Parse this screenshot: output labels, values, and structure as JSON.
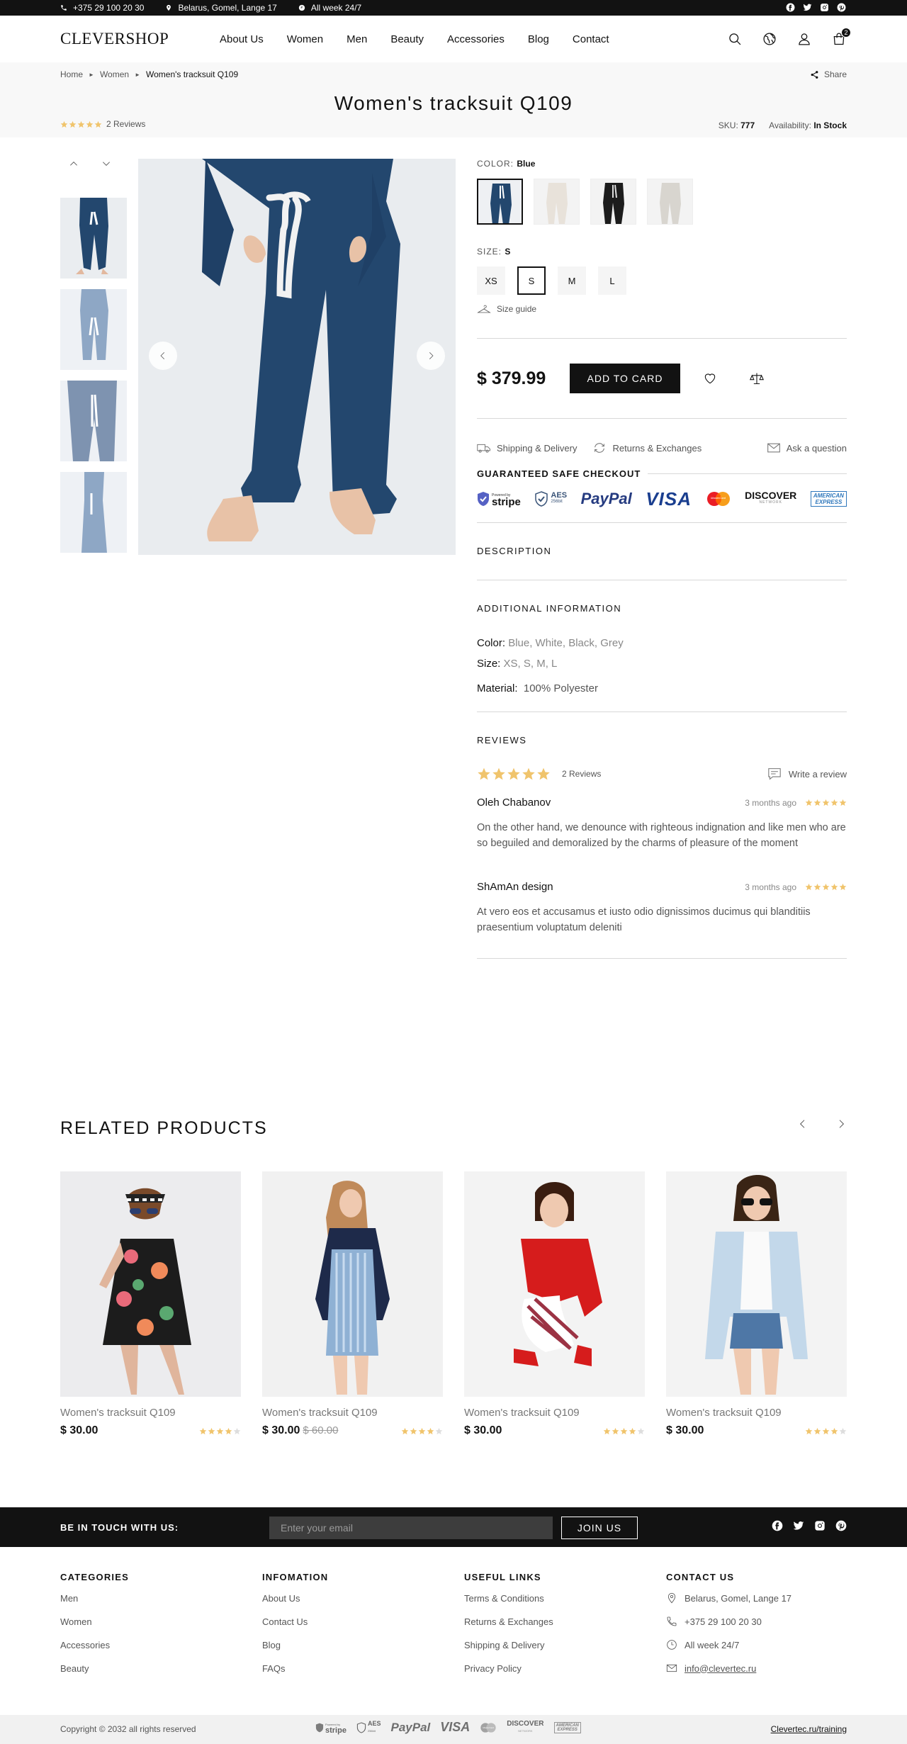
{
  "topbar": {
    "phone": "+375 29 100 20 30",
    "address": "Belarus, Gomel, Lange 17",
    "hours": "All week 24/7",
    "socials": [
      "facebook-icon",
      "twitter-icon",
      "instagram-icon",
      "pinterest-icon"
    ]
  },
  "header": {
    "logo": "CLEVERSHOP",
    "nav": [
      "About Us",
      "Women",
      "Men",
      "Beauty",
      "Accessories",
      "Blog",
      "Contact"
    ],
    "cart_count": "2"
  },
  "breadcrumb": {
    "home": "Home",
    "category": "Women",
    "current": "Women's tracksuit Q109",
    "share": "Share"
  },
  "product": {
    "title": "Women's tracksuit Q109",
    "reviews_count": "2 Reviews",
    "rating": 5,
    "sku_label": "SKU:",
    "sku": "777",
    "availability_label": "Availability:",
    "availability": "In Stock",
    "color_label": "COLOR:",
    "color": "Blue",
    "color_options": [
      "Blue",
      "White",
      "Black",
      "Grey"
    ],
    "size_label": "SIZE:",
    "size": "S",
    "sizes": [
      "XS",
      "S",
      "M",
      "L"
    ],
    "size_guide": "Size guide",
    "price": "$ 379.99",
    "add_to_cart": "ADD TO CARD",
    "shipping": "Shipping & Delivery",
    "returns": "Returns & Exchanges",
    "ask": "Ask a question",
    "safe_checkout": "GUARANTEED SAFE CHECKOUT",
    "payments": {
      "stripe": "stripe",
      "stripe_top": "Powered by",
      "aes": "AES",
      "aes_sub": "256bit",
      "paypal": "PayPal",
      "visa": "VISA",
      "mastercard": "MasterCard",
      "discover": "DISCOVER",
      "discover_sub": "NETWORK",
      "amex1": "AMERICAN",
      "amex2": "EXPRESS"
    }
  },
  "tabs": {
    "description": "DESCRIPTION",
    "additional": "ADDITIONAL INFORMATION",
    "reviews": "REVIEWS"
  },
  "additional_info": {
    "color_label": "Color:",
    "color_value": "Blue, White, Black, Grey",
    "size_label": "Size:",
    "size_value": "XS, S, M, L",
    "material_label": "Material:",
    "material_value": "100% Polyester"
  },
  "reviews": {
    "count": "2 Reviews",
    "write": "Write a review",
    "items": [
      {
        "name": "Oleh Chabanov",
        "ago": "3 months ago",
        "rating": 5,
        "text": "On the other hand, we denounce with righteous indignation and like men who are so beguiled and demoralized by the charms of pleasure of the moment"
      },
      {
        "name": "ShAmAn design",
        "ago": "3 months ago",
        "rating": 5,
        "text": "At vero eos et accusamus et iusto odio dignissimos ducimus qui blanditiis praesentium voluptatum deleniti"
      }
    ]
  },
  "related": {
    "title": "RELATED PRODUCTS",
    "products": [
      {
        "name": "Women's tracksuit Q109",
        "price": "$ 30.00",
        "old_price": "",
        "rating": 4
      },
      {
        "name": "Women's tracksuit Q109",
        "price": "$ 30.00",
        "old_price": "$ 60.00",
        "rating": 4
      },
      {
        "name": "Women's tracksuit Q109",
        "price": "$ 30.00",
        "old_price": "",
        "rating": 4
      },
      {
        "name": "Women's tracksuit Q109",
        "price": "$ 30.00",
        "old_price": "",
        "rating": 4
      }
    ]
  },
  "newsletter": {
    "title": "BE IN TOUCH WITH US:",
    "placeholder": "Enter your email",
    "button": "JOIN US"
  },
  "footer": {
    "categories": {
      "title": "CATEGORIES",
      "items": [
        "Men",
        "Women",
        "Accessories",
        "Beauty"
      ]
    },
    "information": {
      "title": "INFOMATION",
      "items": [
        "About Us",
        "Contact Us",
        "Blog",
        "FAQs"
      ]
    },
    "useful": {
      "title": "USEFUL LINKS",
      "items": [
        "Terms & Conditions",
        "Returns & Exchanges",
        "Shipping & Delivery",
        "Privacy Policy"
      ]
    },
    "contact": {
      "title": "CONTACT US",
      "address": "Belarus, Gomel, Lange 17",
      "phone": "+375 29 100 20 30",
      "hours": "All week 24/7",
      "email": "info@clevertec.ru"
    },
    "copyright": "Copyright © 2032 all rights reserved",
    "training": "Clevertec.ru/training"
  },
  "colors": {
    "accent": "#121212",
    "star": "#f0c46c",
    "star_empty": "#dddddd",
    "product_blue": "#23476e"
  }
}
